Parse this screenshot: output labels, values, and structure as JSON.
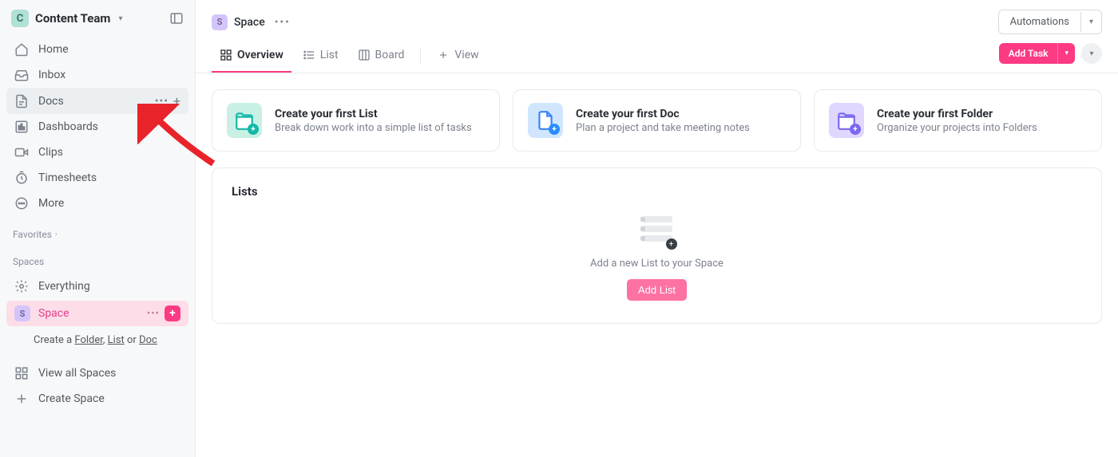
{
  "sidebar": {
    "team_initial": "C",
    "team_name": "Content Team",
    "nav": [
      {
        "label": "Home"
      },
      {
        "label": "Inbox"
      },
      {
        "label": "Docs"
      },
      {
        "label": "Dashboards"
      },
      {
        "label": "Clips"
      },
      {
        "label": "Timesheets"
      },
      {
        "label": "More"
      }
    ],
    "favorites_label": "Favorites",
    "spaces_label": "Spaces",
    "everything_label": "Everything",
    "space": {
      "initial": "S",
      "name": "Space"
    },
    "hint_prefix": "Create a ",
    "hint_folder": "Folder",
    "hint_list": "List",
    "hint_or": " or ",
    "hint_doc": "Doc",
    "hint_sep": ", ",
    "view_all_spaces": "View all Spaces",
    "create_space": "Create Space"
  },
  "topbar": {
    "crumb_initial": "S",
    "crumb_name": "Space",
    "automations_label": "Automations"
  },
  "tabs": {
    "overview": "Overview",
    "list": "List",
    "board": "Board",
    "view": "View",
    "add_task": "Add Task"
  },
  "cards": {
    "list": {
      "title": "Create your first List",
      "sub": "Break down work into a simple list of tasks"
    },
    "doc": {
      "title": "Create your first Doc",
      "sub": "Plan a project and take meeting notes"
    },
    "folder": {
      "title": "Create your first Folder",
      "sub": "Organize your projects into Folders"
    }
  },
  "lists_panel": {
    "title": "Lists",
    "empty_text": "Add a new List to your Space",
    "button": "Add List"
  }
}
